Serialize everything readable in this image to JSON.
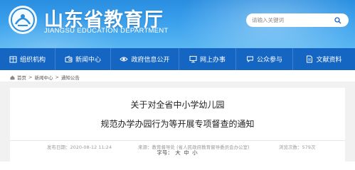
{
  "header": {
    "title": "山东省教育厅",
    "subtitle": "JIANGSU EDUCATION DEPARTMENT",
    "search_placeholder": "请输入关键词",
    "colors": {
      "banner_top": "#2a8ee0",
      "banner_bottom": "#59b6f2"
    }
  },
  "nav": {
    "color": "#1566c2",
    "items": [
      {
        "label": "组织机构",
        "icon": "building-icon"
      },
      {
        "label": "新闻中心",
        "icon": "radio-icon"
      },
      {
        "label": "政府信息公开",
        "icon": "eye-icon"
      },
      {
        "label": "网上办事",
        "icon": "monitor-icon"
      },
      {
        "label": "公众参与",
        "icon": "chat-icon"
      },
      {
        "label": "文献资料",
        "icon": "document-icon"
      }
    ]
  },
  "breadcrumb": {
    "items": [
      "首页",
      "新闻中心",
      "通知公告"
    ],
    "separator": ">"
  },
  "article": {
    "title_line1": "关于对全省中小学幼儿园",
    "title_line2": "规范办学办园行为等开展专项督查的通知",
    "meta": {
      "date": "发布日期：2020-08-12 11:24",
      "source": "来源：教育督导处  (省人民政府教育督导委员会办公室)",
      "views": "浏览次数：579次"
    },
    "font_size": {
      "label": "字号：",
      "options": [
        "大",
        "中",
        "小"
      ]
    }
  }
}
